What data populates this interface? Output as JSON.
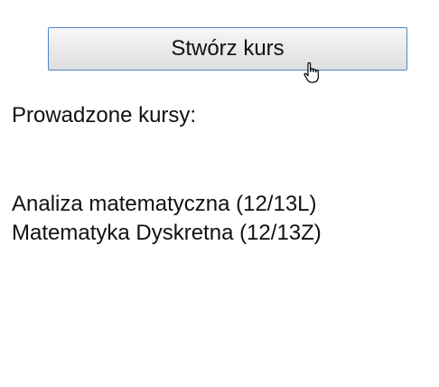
{
  "toolbar": {
    "create_course_label": "Stwórz kurs"
  },
  "cursor": {
    "icon": "hand-pointer-icon"
  },
  "main": {
    "section_title": "Prowadzone kursy:",
    "courses": [
      {
        "label": "Analiza matematyczna (12/13L)"
      },
      {
        "label": "Matematyka Dyskretna (12/13Z)"
      }
    ]
  }
}
